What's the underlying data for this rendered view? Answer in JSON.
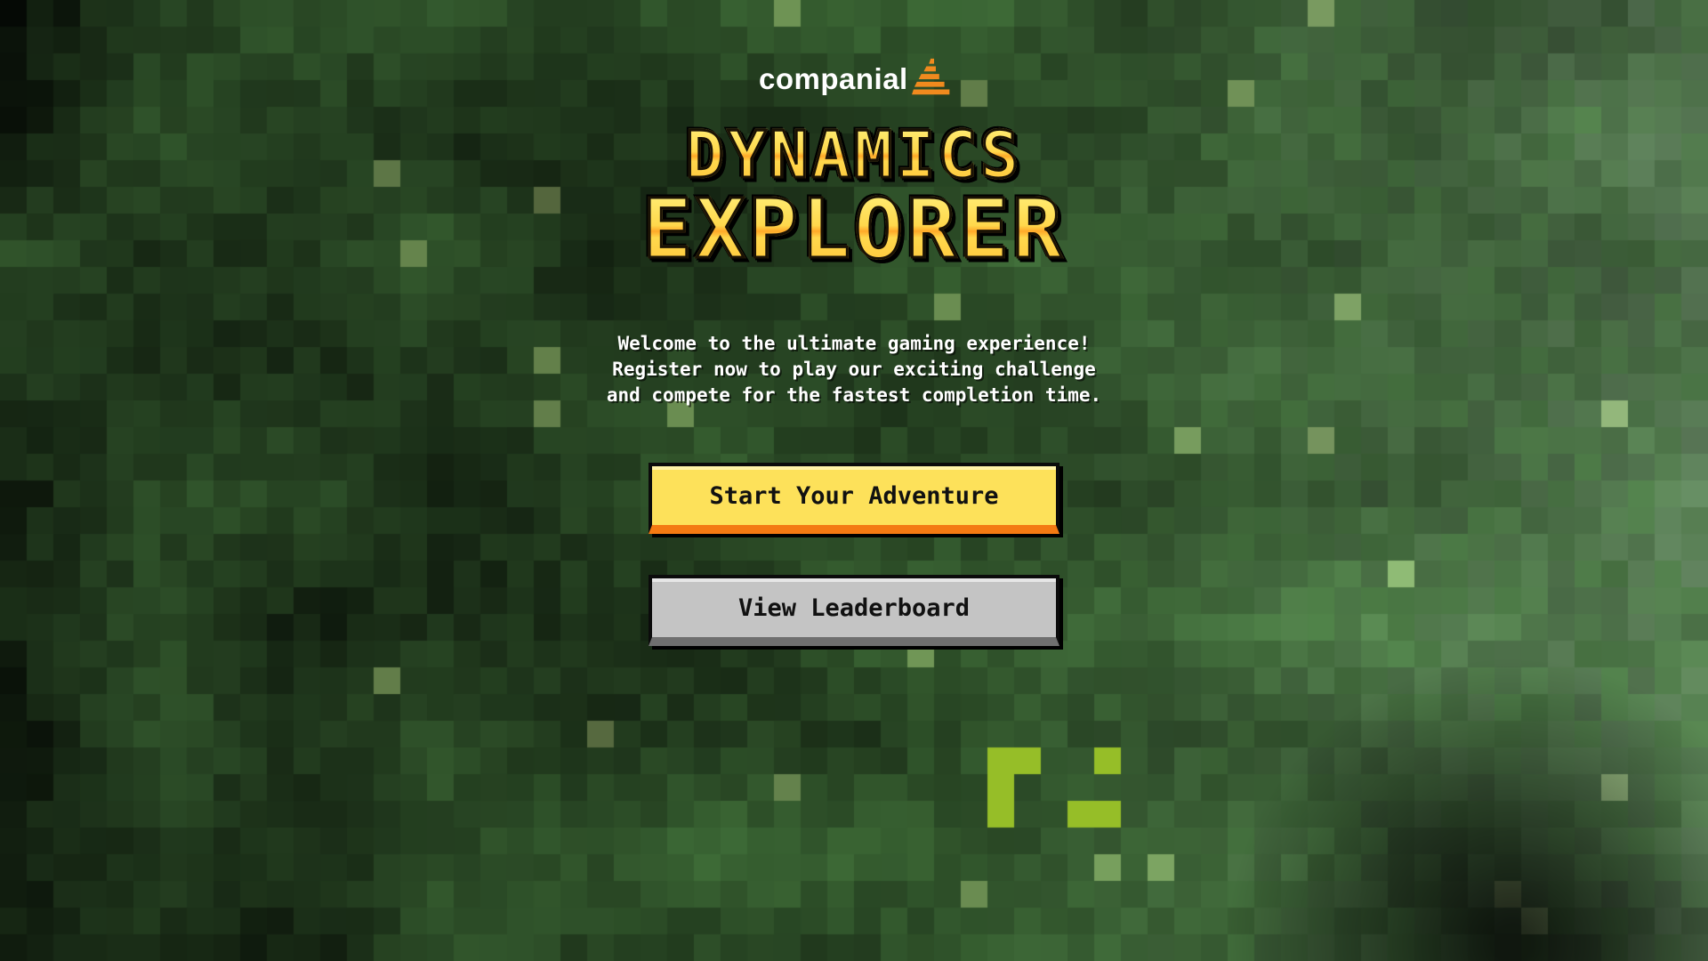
{
  "brand": {
    "logo_text": "companial",
    "accent_color": "#f08a1e"
  },
  "title": {
    "line1": "DYNAMICS",
    "line2": "EXPLORER",
    "fill_color": "#ffd84c",
    "stripe_color": "#ffa928"
  },
  "intro": {
    "line1": "Welcome to the ultimate gaming experience!",
    "line2": "Register now to play our exciting challenge",
    "line3": "and compete for the fastest completion time."
  },
  "buttons": {
    "start_label": "Start Your Adventure",
    "leaderboard_label": "View Leaderboard"
  },
  "colors": {
    "primary_button": "#fde15a",
    "primary_button_shadow": "#f47a12",
    "secondary_button": "#c4c4c4",
    "secondary_button_shadow": "#6f6f6f"
  },
  "background": {
    "style": "pixelated forest",
    "palette": [
      "#0c1a0e",
      "#132a14",
      "#1d3a1a",
      "#2a4a22",
      "#3d5c2c",
      "#4f6e3a",
      "#6a8a52",
      "#8aa66a",
      "#a9bd86",
      "#5d6f66",
      "#7d9184",
      "#9aaf7a",
      "#b7c98a",
      "#cfd8a8",
      "#2f4f2a",
      "#223322"
    ]
  }
}
